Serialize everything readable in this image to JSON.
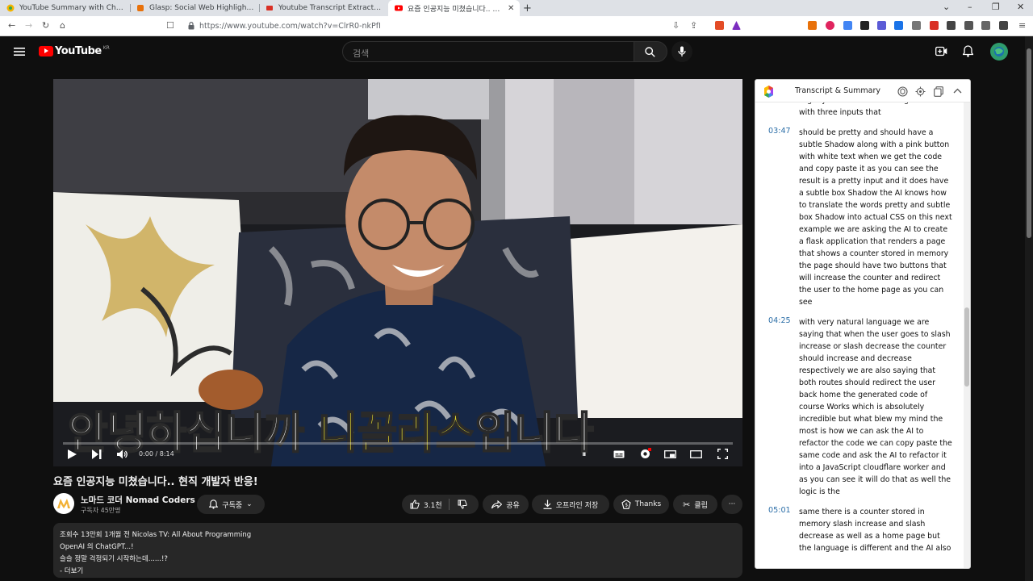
{
  "browser": {
    "tabs": [
      {
        "title": "YouTube Summary with ChatGPT / G",
        "active": false
      },
      {
        "title": "Glasp: Social Web Highlighter & No",
        "active": false
      },
      {
        "title": "Youtube Transcript Extractor - Chrom",
        "active": false
      },
      {
        "title": "요즘 인공지능 미쳤습니다.. 현직",
        "active": true
      }
    ],
    "new_tab_label": "+",
    "url": "https://www.youtube.com/watch?v=ClrR0-nkPfI"
  },
  "yt": {
    "logo_text": "YouTube",
    "region": "KR",
    "search_placeholder": "검색"
  },
  "video": {
    "subtitle_white": "안녕하십니까 ",
    "subtitle_yellow": "니꼴라스",
    "subtitle_white2": "입니다",
    "time": "0:00 / 8:14",
    "progress_fraction": 0.0
  },
  "info": {
    "title": "요즘 인공지능 미쳤습니다.. 현직 개발자 반응!",
    "channel": "노마드 코더 Nomad Coders",
    "subscribers": "구독자 45만명",
    "subscribe_label": "구독중",
    "like_count": "3.1천",
    "share_label": "공유",
    "offline_label": "오프라인 저장",
    "thanks_label": "Thanks",
    "clip_label": "클립",
    "more_label": "···",
    "desc_line1": "조회수 13만회  1개월 전  Nicolas TV: All About Programming",
    "desc_line2": "OpenAI 의 ChatGPT...!",
    "desc_line3": "슬슬 정말 걱정되기 시작하는데......!?",
    "desc_more": "- 더보기"
  },
  "panel": {
    "title": "Transcript & Summary",
    "fragment": "slightly fold that has a background color with three inputs that",
    "segments": [
      {
        "time": "03:47",
        "text": "should be pretty and should have a subtle Shadow along with a pink button with white text when we get the code and copy paste it as you can see the result is a pretty input and it does have a subtle box Shadow the AI knows how to translate the words pretty and subtle box Shadow into actual CSS on this next example we are asking the AI to create a flask application that renders a page that shows a counter stored in memory the page should have two buttons that will increase the counter and redirect the user to the home page as you can see"
      },
      {
        "time": "04:25",
        "text": "with very natural language we are saying that when the user goes to slash increase or slash decrease the counter should increase and decrease respectively we are also saying that both routes should redirect the user back home the generated code of course Works which is absolutely incredible but what blew my mind the most is how we can ask the AI to refactor the code we can copy paste the same code and ask the AI to refactor it into a JavaScript cloudflare worker and as you can see it will do that as well the logic is the"
      },
      {
        "time": "05:01",
        "text": "same there is a counter stored in memory slash increase and slash decrease as well as a home page but the language is different and the AI also"
      }
    ]
  },
  "colors": {
    "yt_red": "#ff0000",
    "timestamp": "#2d6fa8",
    "subtitle_yellow": "#e3d72e",
    "bg": "#0f0f0f"
  }
}
